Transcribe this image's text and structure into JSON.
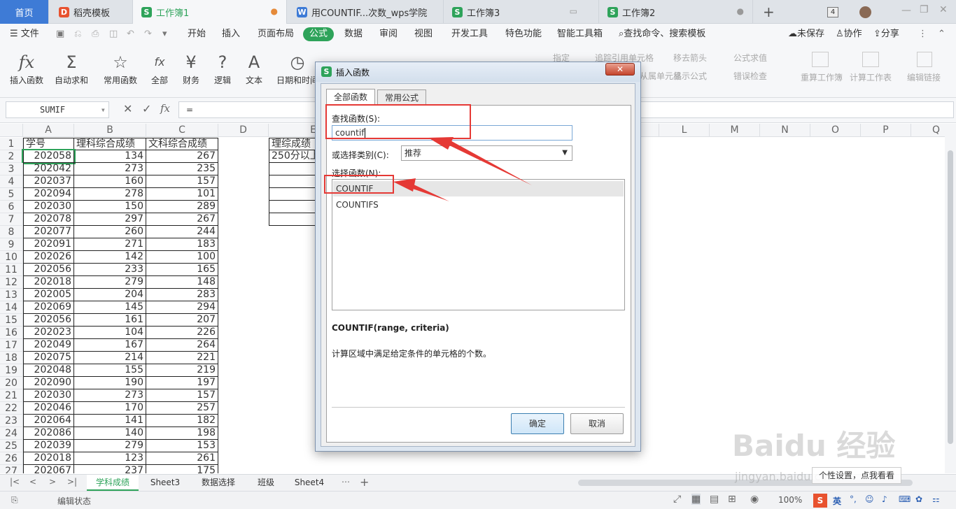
{
  "tabs": [
    {
      "label": "首页"
    },
    {
      "label": "稻壳模板",
      "icon": "dk-icon"
    },
    {
      "label": "工作簿1",
      "icon": "sheet-icon",
      "tail": "●"
    },
    {
      "label": "用COUNTIF...次数_wps学院",
      "icon": "word-icon"
    },
    {
      "label": "工作簿3",
      "icon": "sheet-icon"
    },
    {
      "label": "工作簿2",
      "icon": "sheet-icon",
      "tail": "●"
    }
  ],
  "window": {
    "tab_count": "4",
    "plus": "+"
  },
  "menu": {
    "file": "文件",
    "items": [
      "开始",
      "插入",
      "页面布局",
      "公式",
      "数据",
      "审阅",
      "视图",
      "开发工具",
      "特色功能",
      "智能工具箱"
    ],
    "active": "公式",
    "search": "查找命令、搜索模板",
    "unsaved": "未保存",
    "collab": "协作",
    "share": "分享"
  },
  "ribbon": {
    "buttons": [
      {
        "label": "插入函数",
        "icon": "fx"
      },
      {
        "label": "自动求和",
        "icon": "Σ"
      },
      {
        "label": "常用函数",
        "icon": "☆"
      },
      {
        "label": "全部",
        "icon": "fx"
      },
      {
        "label": "财务",
        "icon": "¥"
      },
      {
        "label": "逻辑",
        "icon": "?"
      },
      {
        "label": "文本",
        "icon": "A"
      },
      {
        "label": "日期和时间",
        "icon": "◷"
      }
    ],
    "right": [
      "指定",
      "追踪引用单元格",
      "移去箭头",
      "公式求值",
      "追踪从属单元格",
      "显示公式",
      "错误检查",
      "重算工作簿",
      "计算工作表",
      "编辑链接"
    ]
  },
  "formula_bar": {
    "name_box": "SUMIF",
    "formula": "=",
    "fx": "fx"
  },
  "grid": {
    "columns": [
      "A",
      "B",
      "C",
      "D",
      "E",
      "L",
      "M",
      "N",
      "O",
      "P",
      "Q"
    ],
    "headers": [
      "学号",
      "理科综合成绩",
      "文科综合成绩"
    ],
    "rows": [
      [
        "202058",
        "134",
        "267"
      ],
      [
        "202042",
        "273",
        "235"
      ],
      [
        "202037",
        "160",
        "157"
      ],
      [
        "202094",
        "278",
        "101"
      ],
      [
        "202030",
        "150",
        "289"
      ],
      [
        "202078",
        "297",
        "267"
      ],
      [
        "202077",
        "260",
        "244"
      ],
      [
        "202091",
        "271",
        "183"
      ],
      [
        "202026",
        "142",
        "100"
      ],
      [
        "202056",
        "233",
        "165"
      ],
      [
        "202018",
        "279",
        "148"
      ],
      [
        "202005",
        "204",
        "283"
      ],
      [
        "202069",
        "145",
        "294"
      ],
      [
        "202056",
        "161",
        "207"
      ],
      [
        "202023",
        "104",
        "226"
      ],
      [
        "202049",
        "167",
        "264"
      ],
      [
        "202075",
        "214",
        "221"
      ],
      [
        "202048",
        "155",
        "219"
      ],
      [
        "202090",
        "190",
        "197"
      ],
      [
        "202030",
        "273",
        "157"
      ],
      [
        "202046",
        "170",
        "257"
      ],
      [
        "202064",
        "141",
        "182"
      ],
      [
        "202086",
        "140",
        "198"
      ],
      [
        "202039",
        "279",
        "153"
      ],
      [
        "202018",
        "123",
        "261"
      ],
      [
        "202067",
        "237",
        "175"
      ]
    ],
    "e1": "理综成绩",
    "e2": "250分以上"
  },
  "dialog": {
    "title": "插入函数",
    "tabs": [
      "全部函数",
      "常用公式"
    ],
    "search_label": "查找函数(S):",
    "search_value": "countif",
    "category_label": "或选择类别(C):",
    "category_value": "推荐",
    "list_label": "选择函数(N):",
    "functions": [
      "COUNTIF",
      "COUNTIFS"
    ],
    "signature": "COUNTIF(range, criteria)",
    "description": "计算区域中满足给定条件的单元格的个数。",
    "ok": "确定",
    "cancel": "取消"
  },
  "sheets": [
    "学科成绩",
    "Sheet3",
    "数据选择",
    "班级",
    "Sheet4"
  ],
  "status": {
    "mode": "编辑状态",
    "zoom": "100%",
    "ime": "英"
  },
  "watermark": {
    "text1": "Baidu 经验",
    "text2": "jingyan.baidu.com",
    "overlay": "个性设置，点我看看"
  },
  "colors": {
    "accent": "#2ea35a",
    "home": "#3e7bd6",
    "annotation": "#e53935"
  }
}
